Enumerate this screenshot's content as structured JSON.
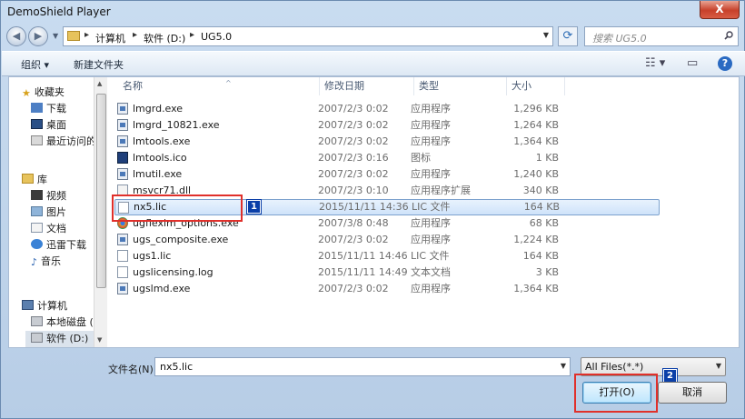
{
  "window": {
    "title": "DemoShield Player",
    "close_glyph": "X"
  },
  "nav": {
    "back_glyph": "◀",
    "forward_glyph": "▶"
  },
  "address": {
    "crumbs": [
      "计算机",
      "软件 (D:)",
      "UG5.0"
    ],
    "separator": "▸"
  },
  "search": {
    "placeholder": "搜索 UG5.0"
  },
  "toolbar": {
    "organize": "组织 ▾",
    "new_folder": "新建文件夹",
    "help": "?"
  },
  "sidebar": {
    "favorites": {
      "label": "收藏夹",
      "items": [
        "下载",
        "桌面",
        "最近访问的"
      ]
    },
    "libraries": {
      "label": "库",
      "items": [
        "视频",
        "图片",
        "文档",
        "迅雷下载",
        "音乐"
      ]
    },
    "computer": {
      "label": "计算机",
      "items": [
        "本地磁盘 (",
        "软件 (D:)"
      ]
    }
  },
  "columns": {
    "name": "名称",
    "modified": "修改日期",
    "type": "类型",
    "size": "大小"
  },
  "files": [
    {
      "name": "lmgrd.exe",
      "date": "2007/2/3 0:02",
      "type": "应用程序",
      "size": "1,296 KB",
      "icon": "exe-icon"
    },
    {
      "name": "lmgrd_10821.exe",
      "date": "2007/2/3 0:02",
      "type": "应用程序",
      "size": "1,264 KB",
      "icon": "exe-icon"
    },
    {
      "name": "lmtools.exe",
      "date": "2007/2/3 0:02",
      "type": "应用程序",
      "size": "1,364 KB",
      "icon": "exe-icon"
    },
    {
      "name": "lmtools.ico",
      "date": "2007/2/3 0:16",
      "type": "图标",
      "size": "1 KB",
      "icon": "ico-icon"
    },
    {
      "name": "lmutil.exe",
      "date": "2007/2/3 0:02",
      "type": "应用程序",
      "size": "1,240 KB",
      "icon": "exe-icon"
    },
    {
      "name": "msvcr71.dll",
      "date": "2007/2/3 0:10",
      "type": "应用程序扩展",
      "size": "340 KB",
      "icon": "dll-icon"
    },
    {
      "name": "nx5.lic",
      "date": "2015/11/11 14:36",
      "type": "LIC 文件",
      "size": "164 KB",
      "icon": "doc-icon"
    },
    {
      "name": "ugflexlm_options.exe",
      "date": "2007/3/8 0:48",
      "type": "应用程序",
      "size": "68 KB",
      "icon": "chrome-icon"
    },
    {
      "name": "ugs_composite.exe",
      "date": "2007/2/3 0:02",
      "type": "应用程序",
      "size": "1,224 KB",
      "icon": "exe-icon"
    },
    {
      "name": "ugs1.lic",
      "date": "2015/11/11 14:46",
      "type": "LIC 文件",
      "size": "164 KB",
      "icon": "doc-icon"
    },
    {
      "name": "ugslicensing.log",
      "date": "2015/11/11 14:49",
      "type": "文本文档",
      "size": "3 KB",
      "icon": "doc-icon"
    },
    {
      "name": "ugslmd.exe",
      "date": "2007/2/3 0:02",
      "type": "应用程序",
      "size": "1,364 KB",
      "icon": "exe-icon"
    }
  ],
  "filename": {
    "label": "文件名(N):",
    "value": "nx5.lic"
  },
  "filter": {
    "value": "All Files(*.*)"
  },
  "buttons": {
    "open": "打开(O)",
    "cancel": "取消"
  },
  "badges": [
    "1",
    "2"
  ],
  "colors": {
    "highlight": "#e0302b",
    "badge": "#0b3fa8",
    "selection": "#cfe3fa"
  }
}
